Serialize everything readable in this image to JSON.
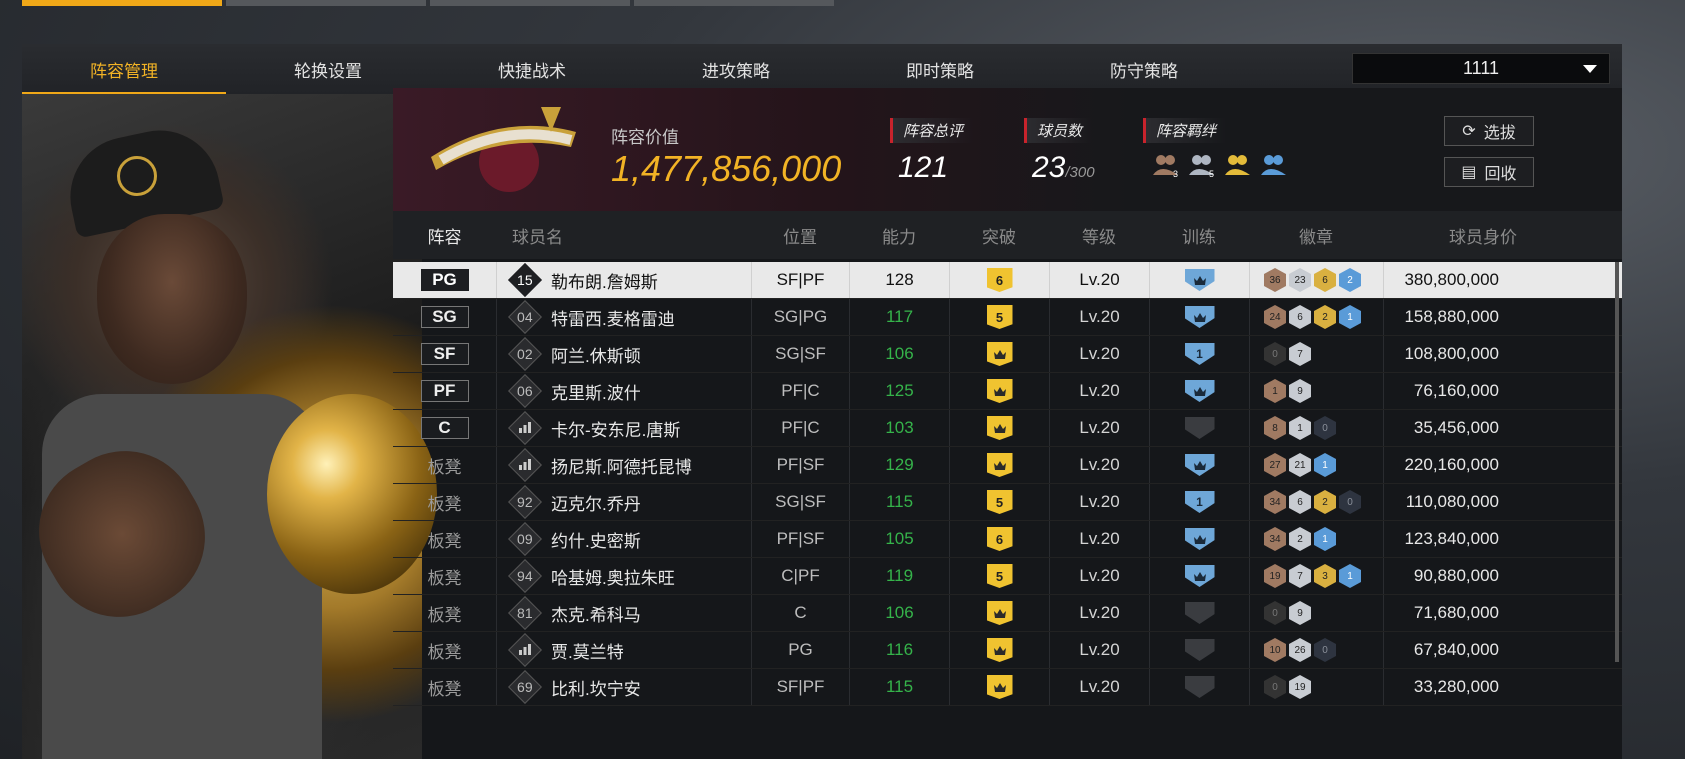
{
  "subnav": {
    "tabs": [
      "阵容管理",
      "轮换设置",
      "快捷战术",
      "进攻策略",
      "即时策略",
      "防守策略"
    ],
    "dropdown_value": "1111"
  },
  "header": {
    "value_label": "阵容价值",
    "value": "1,477,856,000",
    "rating_label": "阵容总评",
    "rating": "121",
    "players_label": "球员数",
    "players_count": "23",
    "players_max": "/300",
    "bond_label": "阵容羁绊",
    "bond_icon_labels": [
      "3",
      "5",
      "",
      ""
    ],
    "scout_label": "选拔",
    "recycle_label": "回收"
  },
  "columns": [
    "阵容",
    "球员名",
    "位置",
    "能力",
    "突破",
    "等级",
    "训练",
    "徽章",
    "球员身价"
  ],
  "rows": [
    {
      "slot": "PG",
      "starter": true,
      "num": "15",
      "name": "勒布朗.詹姆斯",
      "pos": "SF|PF",
      "power": "128",
      "brk": "6",
      "lv": "Lv.20",
      "train": "crown",
      "badges": [
        [
          "36",
          "bronze"
        ],
        [
          "23",
          "silver"
        ],
        [
          "6",
          "gold"
        ],
        [
          "2",
          "blue"
        ]
      ],
      "price": "380,800,000",
      "selected": true
    },
    {
      "slot": "SG",
      "starter": true,
      "num": "04",
      "name": "特雷西.麦格雷迪",
      "pos": "SG|PG",
      "power": "117",
      "brk": "5",
      "lv": "Lv.20",
      "train": "crown",
      "badges": [
        [
          "24",
          "bronze"
        ],
        [
          "6",
          "silver"
        ],
        [
          "2",
          "gold"
        ],
        [
          "1",
          "blue"
        ]
      ],
      "price": "158,880,000"
    },
    {
      "slot": "SF",
      "starter": true,
      "num": "02",
      "name": "阿兰.休斯顿",
      "pos": "SG|SF",
      "power": "106",
      "brk": "crown",
      "lv": "Lv.20",
      "train": "1",
      "badges": [
        [
          "0",
          "gray"
        ],
        [
          "7",
          "silver"
        ]
      ],
      "price": "108,800,000"
    },
    {
      "slot": "PF",
      "starter": true,
      "num": "06",
      "name": "克里斯.波什",
      "pos": "PF|C",
      "power": "125",
      "brk": "crown",
      "lv": "Lv.20",
      "train": "crown",
      "badges": [
        [
          "1",
          "bronze"
        ],
        [
          "9",
          "silver"
        ]
      ],
      "price": "76,160,000"
    },
    {
      "slot": "C",
      "starter": true,
      "num": "bars",
      "name": "卡尔-安东尼.唐斯",
      "pos": "PF|C",
      "power": "103",
      "brk": "crown",
      "lv": "Lv.20",
      "train": "none",
      "badges": [
        [
          "8",
          "bronze"
        ],
        [
          "1",
          "silver"
        ],
        [
          "0",
          "dark"
        ]
      ],
      "price": "35,456,000"
    },
    {
      "slot": "板凳",
      "starter": false,
      "num": "bars",
      "name": "扬尼斯.阿德托昆博",
      "pos": "PF|SF",
      "power": "129",
      "brk": "crown",
      "lv": "Lv.20",
      "train": "crown",
      "badges": [
        [
          "27",
          "bronze"
        ],
        [
          "21",
          "silver"
        ],
        [
          "1",
          "blue"
        ]
      ],
      "price": "220,160,000"
    },
    {
      "slot": "板凳",
      "starter": false,
      "num": "92",
      "name": "迈克尔.乔丹",
      "pos": "SG|SF",
      "power": "115",
      "brk": "5",
      "lv": "Lv.20",
      "train": "1",
      "badges": [
        [
          "34",
          "bronze"
        ],
        [
          "6",
          "silver"
        ],
        [
          "2",
          "gold"
        ],
        [
          "0",
          "dark"
        ]
      ],
      "price": "110,080,000"
    },
    {
      "slot": "板凳",
      "starter": false,
      "num": "09",
      "name": "约什.史密斯",
      "pos": "PF|SF",
      "power": "105",
      "brk": "6",
      "lv": "Lv.20",
      "train": "crown",
      "badges": [
        [
          "34",
          "bronze"
        ],
        [
          "2",
          "silver"
        ],
        [
          "1",
          "blue"
        ]
      ],
      "price": "123,840,000"
    },
    {
      "slot": "板凳",
      "starter": false,
      "num": "94",
      "name": "哈基姆.奥拉朱旺",
      "pos": "C|PF",
      "power": "119",
      "brk": "5",
      "lv": "Lv.20",
      "train": "crown",
      "badges": [
        [
          "19",
          "bronze"
        ],
        [
          "7",
          "silver"
        ],
        [
          "3",
          "gold"
        ],
        [
          "1",
          "blue"
        ]
      ],
      "price": "90,880,000"
    },
    {
      "slot": "板凳",
      "starter": false,
      "num": "81",
      "name": "杰克.希科马",
      "pos": "C",
      "power": "106",
      "brk": "crown",
      "lv": "Lv.20",
      "train": "none",
      "badges": [
        [
          "0",
          "gray"
        ],
        [
          "9",
          "silver"
        ]
      ],
      "price": "71,680,000"
    },
    {
      "slot": "板凳",
      "starter": false,
      "num": "bars",
      "name": "贾.莫兰特",
      "pos": "PG",
      "power": "116",
      "brk": "crown",
      "lv": "Lv.20",
      "train": "none",
      "badges": [
        [
          "10",
          "bronze"
        ],
        [
          "26",
          "silver"
        ],
        [
          "0",
          "dark"
        ]
      ],
      "price": "67,840,000"
    },
    {
      "slot": "板凳",
      "starter": false,
      "num": "69",
      "name": "比利.坎宁安",
      "pos": "SF|PF",
      "power": "115",
      "brk": "crown",
      "lv": "Lv.20",
      "train": "none",
      "badges": [
        [
          "0",
          "gray"
        ],
        [
          "19",
          "silver"
        ]
      ],
      "price": "33,280,000"
    }
  ],
  "colors": {
    "accent": "#f0a818",
    "value": "#f2b325",
    "power": "#35b34a",
    "rating_bar": "#c8232c"
  }
}
